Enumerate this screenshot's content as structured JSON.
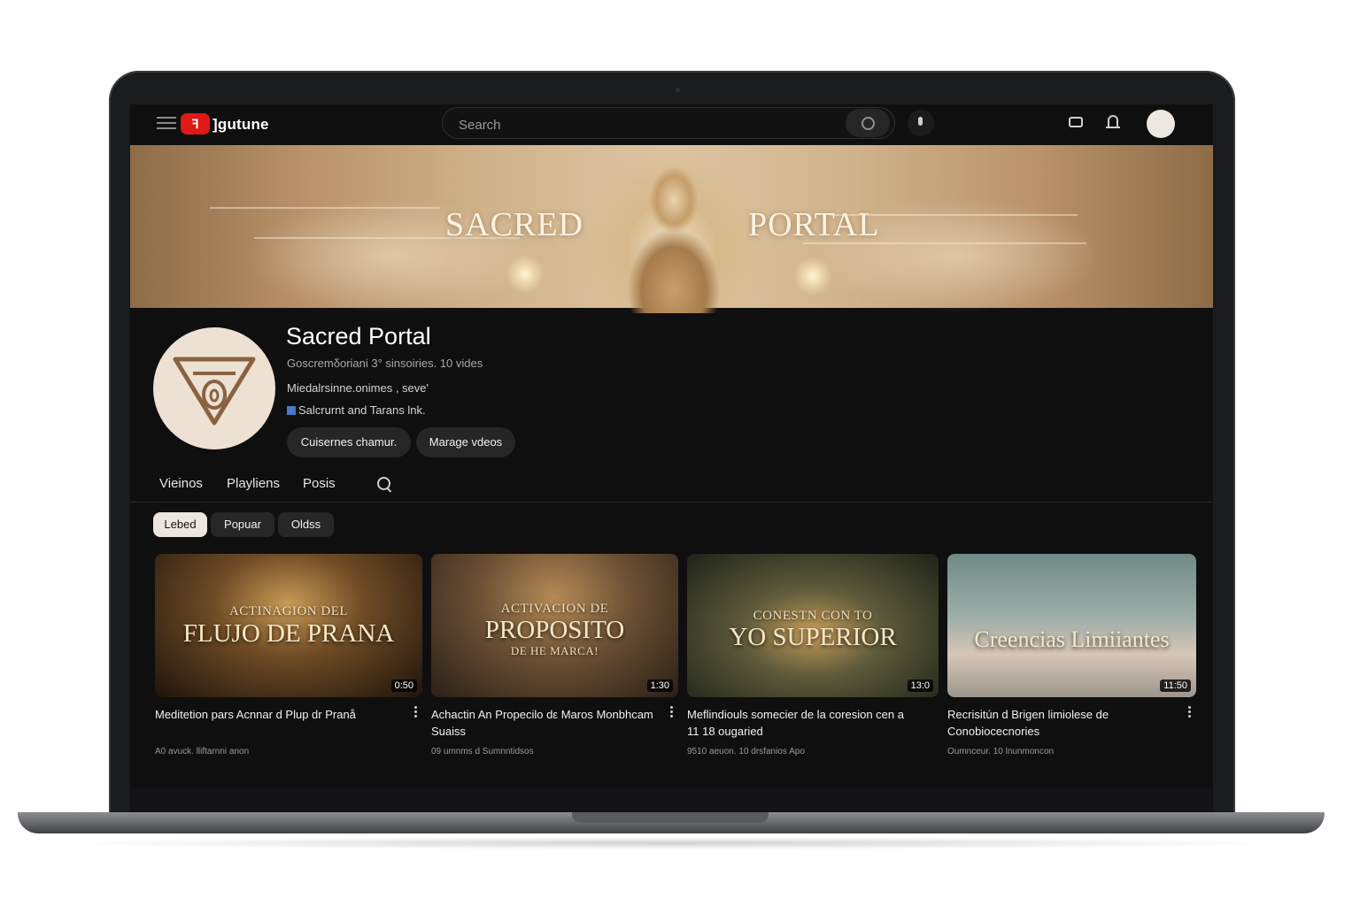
{
  "app": {
    "logo_glyph": "ꟻ",
    "logo_text": "]gutune",
    "brand_color": "#e01818"
  },
  "search": {
    "placeholder": "Search",
    "value": ""
  },
  "banner": {
    "left_word": "SACRED",
    "right_word": "PORTAL"
  },
  "channel": {
    "name": "Sacred Portal",
    "meta": "Goscremδoriani 3° sinsoiries. 10 vides",
    "description": "Miedalrsinne.onimes , seve'",
    "link": "Salcrurnt and Tarans lnk.",
    "customize_label": "Cuisernes chamur.",
    "manage_label": "Marage vdeos"
  },
  "tabs": [
    {
      "label": "Vieinos"
    },
    {
      "label": "Playliens"
    },
    {
      "label": "Posis"
    }
  ],
  "chips": [
    {
      "label": "Lebed",
      "active": true
    },
    {
      "label": "Popuar",
      "active": false
    },
    {
      "label": "Oldss",
      "active": false
    }
  ],
  "videos": [
    {
      "thumb_sub": "ACTINAGION DEL",
      "thumb_main": "FLUJO DE PRANA",
      "thumb_extra": "",
      "duration": "0:50",
      "title": "Meditetion pars Acnnar d Plup dr Pranå",
      "stats": "A0 avuck. lliftarnni anon"
    },
    {
      "thumb_sub": "ACTIVACION DE",
      "thumb_main": "PROPOSITO",
      "thumb_extra": "DE HE MARCA!",
      "duration": "1:30",
      "title": "Achactin An Propecilo dε Maros Monbhcam Suaiss",
      "stats": "09 umnms d Sumnntidsos"
    },
    {
      "thumb_sub": "CONESTN CON TO",
      "thumb_main": "YO SUPERIOR",
      "thumb_extra": "",
      "duration": "13:0",
      "title": "Meflindiouls somecier de la coresion cen a 11 18 ougaried",
      "stats": "9510 aeuon. 10 drsfanios Apo"
    },
    {
      "thumb_sub": "",
      "thumb_main": "Creencias Limiiantes",
      "thumb_extra": "",
      "duration": "11:50",
      "title": "Recrisitún d Brigen limiolese de Conobiocecnories",
      "stats": "Oumnceur. 10 lnunmoncon"
    }
  ]
}
